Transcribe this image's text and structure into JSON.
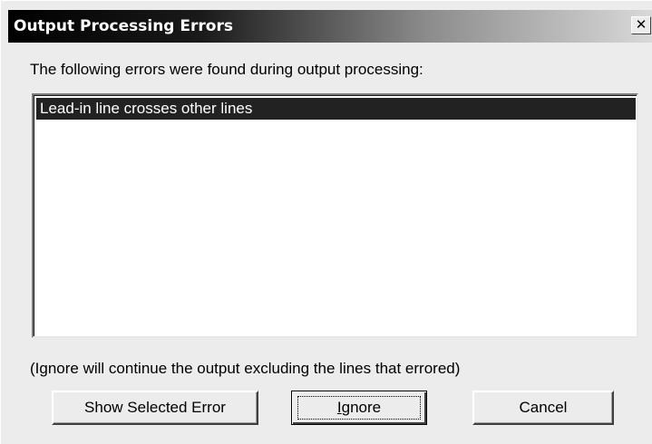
{
  "window": {
    "title": "Output Processing Errors",
    "close_glyph": "✕"
  },
  "description": "The following errors were found during output processing:",
  "error_list": {
    "items": [
      {
        "label": "Lead-in line crosses other lines",
        "selected": true
      }
    ]
  },
  "note": "(Ignore will continue the output excluding the lines that errored)",
  "buttons": {
    "show_selected_error": "Show Selected Error",
    "ignore_prefix": "",
    "ignore_accel": "I",
    "ignore_suffix": "gnore",
    "cancel": "Cancel"
  },
  "colors": {
    "dialog_bg": "#ececec",
    "selection_bg": "#222222",
    "selection_fg": "#ffffff"
  }
}
